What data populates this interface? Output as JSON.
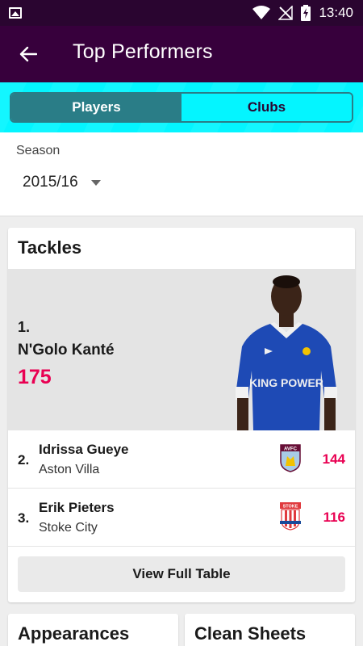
{
  "status_bar": {
    "time": "13:40",
    "icons": [
      "image-icon",
      "wifi-icon",
      "no-signal-icon",
      "battery-charging-icon"
    ]
  },
  "app_bar": {
    "title": "Top Performers",
    "back_icon": "arrow-left-icon"
  },
  "toggle": {
    "options": [
      "Players",
      "Clubs"
    ],
    "selected": "Players"
  },
  "season": {
    "label": "Season",
    "value": "2015/16"
  },
  "card": {
    "title": "Tackles",
    "leader": {
      "rank": "1.",
      "name": "N'Golo Kanté",
      "value": "175",
      "shirt_text": "KING POWER"
    },
    "rows": [
      {
        "rank": "2.",
        "name": "Idrissa Gueye",
        "club": "Aston Villa",
        "crest": "AVFC",
        "value": "144"
      },
      {
        "rank": "3.",
        "name": "Erik Pieters",
        "club": "Stoke City",
        "crest": "STOKE",
        "value": "116"
      }
    ],
    "view_button": "View Full Table"
  },
  "more_cards": [
    "Appearances",
    "Clean Sheets"
  ],
  "colors": {
    "header": "#37003c",
    "accent": "#04f5ff",
    "value": "#e90052",
    "toggle_active": "#2a7d87"
  }
}
